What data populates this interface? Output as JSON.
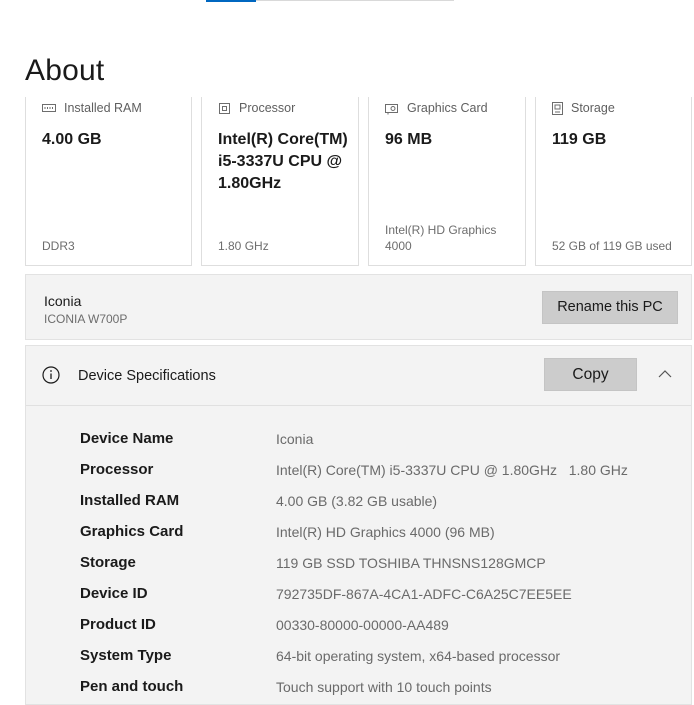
{
  "page": {
    "title": "About"
  },
  "cards": [
    {
      "label": "Installed RAM",
      "icon": "ram-icon",
      "value": "4.00 GB",
      "foot": "DDR3"
    },
    {
      "label": "Processor",
      "icon": "processor-icon",
      "value": "Intel(R) Core(TM)\ni5-3337U CPU @\n1.80GHz",
      "foot": "1.80 GHz"
    },
    {
      "label": "Graphics Card",
      "icon": "graphics-card-icon",
      "value": "96 MB",
      "foot": "Intel(R) HD Graphics\n4000"
    },
    {
      "label": "Storage",
      "icon": "storage-icon",
      "value": "119 GB",
      "foot": "52 GB of 119 GB used"
    }
  ],
  "pc": {
    "name": "Iconia",
    "model": "ICONIA W700P",
    "rename_label": "Rename this PC"
  },
  "specs": {
    "title": "Device Specifications",
    "copy_label": "Copy",
    "rows": [
      {
        "label": "Device Name",
        "value": "Iconia"
      },
      {
        "label": "Processor",
        "value": "Intel(R) Core(TM) i5-3337U CPU @ 1.80GHz   1.80 GHz"
      },
      {
        "label": "Installed RAM",
        "value": "4.00 GB (3.82 GB usable)"
      },
      {
        "label": "Graphics Card",
        "value": "Intel(R) HD Graphics 4000 (96 MB)"
      },
      {
        "label": "Storage",
        "value": "119 GB SSD TOSHIBA THNSNS128GMCP"
      },
      {
        "label": "Device ID",
        "value": "792735DF-867A-4CA1-ADFC-C6A25C7EE5EE"
      },
      {
        "label": "Product ID",
        "value": "00330-80000-00000-AA489"
      },
      {
        "label": "System Type",
        "value": "64-bit operating system, x64-based processor"
      },
      {
        "label": "Pen and touch",
        "value": "Touch support with 10 touch points"
      }
    ]
  },
  "colors": {
    "accent": "#0067c0",
    "panel": "#f3f3f3",
    "button": "#cccccc"
  }
}
